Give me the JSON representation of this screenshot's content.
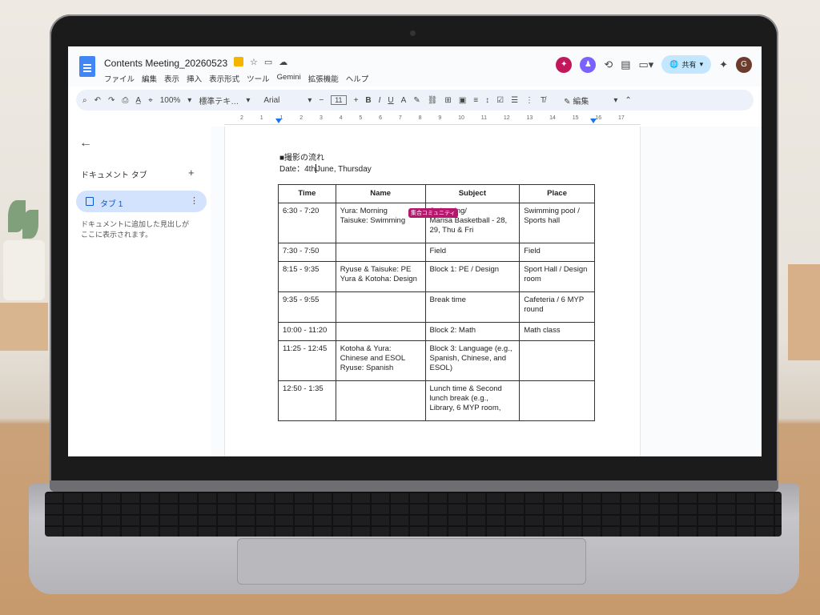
{
  "doc": {
    "title": "Contents Meeting_20260523",
    "menus": [
      "ファイル",
      "編集",
      "表示",
      "挿入",
      "表示形式",
      "ツール",
      "Gemini",
      "拡張機能",
      "ヘルプ"
    ],
    "share_label": "共有",
    "user_initial": "G"
  },
  "toolbar": {
    "zoom": "100%",
    "style": "標準テキ…",
    "font": "Arial",
    "font_size": "11",
    "edit_mode": "編集"
  },
  "ruler": [
    "2",
    "1",
    "1",
    "2",
    "3",
    "4",
    "5",
    "6",
    "7",
    "8",
    "9",
    "10",
    "11",
    "12",
    "13",
    "14",
    "15",
    "16",
    "17"
  ],
  "sidebar": {
    "tabs_title": "ドキュメント タブ",
    "tab_label": "タブ 1",
    "help_text": "ドキュメントに追加した見出しがここに表示されます。"
  },
  "content": {
    "section_title": "■撮影の流れ",
    "date_prefix": "Date：4th",
    "date_suffix": "June, Thursday",
    "comment_badge": "集合コミュニティ",
    "headers": [
      "Time",
      "Name",
      "Subject",
      "Place"
    ],
    "rows": [
      [
        "6:30 - 7:20",
        "Yura: Morning\nTaisuke: Swimming",
        "Swimming/\nMarisa Basketball - 28, 29, Thu & Fri",
        "Swimming pool / Sports hall"
      ],
      [
        "7:30 - 7:50",
        "",
        "Field",
        "Field"
      ],
      [
        "8:15 - 9:35",
        "Ryuse & Taisuke: PE\nYura & Kotoha: Design",
        "Block 1: PE / Design",
        "Sport Hall / Design room"
      ],
      [
        "9:35 - 9:55",
        "",
        "Break time",
        "Cafeteria / 6 MYP round"
      ],
      [
        "10:00 - 11:20",
        "",
        "Block 2: Math",
        "Math class"
      ],
      [
        "11:25 - 12:45",
        "Kotoha & Yura: Chinese and ESOL\nRyuse: Spanish",
        "Block 3: Language (e.g., Spanish, Chinese, and ESOL)",
        ""
      ],
      [
        "12:50 - 1:35",
        "",
        "Lunch time & Second lunch break (e.g., Library, 6 MYP room,",
        ""
      ]
    ]
  }
}
